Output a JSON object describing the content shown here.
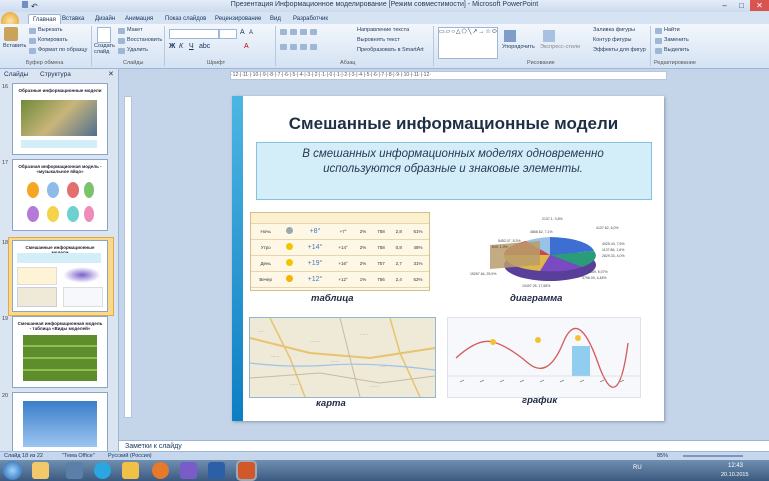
{
  "window": {
    "title": "Презентация Информационное моделирование [Режим совместимости] - Microsoft PowerPoint",
    "min": "–",
    "max": "□",
    "close": "✕"
  },
  "tabs": [
    "Главная",
    "Вставка",
    "Дизайн",
    "Анимация",
    "Показ слайдов",
    "Рецензирование",
    "Вид",
    "Разработчик"
  ],
  "ribbon": {
    "clipboard": {
      "paste": "Вставить",
      "cut": "Вырезать",
      "copy": "Копировать",
      "format": "Формат по образцу",
      "group": "Буфер обмена"
    },
    "slides": {
      "create": "Создать слайд",
      "layout": "Макет",
      "reset": "Восстановить",
      "delete": "Удалить",
      "group": "Слайды"
    },
    "font_group": "Шрифт",
    "paragraph": {
      "direction": "Направление текста",
      "align": "Выровнять текст",
      "smartart": "Преобразовать в SmartArt",
      "group": "Абзац"
    },
    "drawing": {
      "arrange": "Упорядочить",
      "styles": "Экспресс-стили",
      "fill": "Заливка фигуры",
      "outline": "Контур фигуры",
      "effects": "Эффекты для фигур",
      "group": "Рисование"
    },
    "editing": {
      "find": "Найти",
      "replace": "Заменить",
      "select": "Выделить",
      "group": "Редактирование"
    }
  },
  "left_panel": {
    "tab_slides": "Слайды",
    "tab_outline": "Структура",
    "thumbs": [
      {
        "num": "16",
        "title": "Образные информационные модели"
      },
      {
        "num": "17",
        "title": "Образная информационная модель - «музыкальное яйцо»"
      },
      {
        "num": "18",
        "title": "Смешанные информационные модели"
      },
      {
        "num": "19",
        "title": "Смешанная информационная модель - таблица «Виды моделей»"
      },
      {
        "num": "20",
        "title": ""
      }
    ]
  },
  "ruler": "·12·|·11·|·10·|·9·|·8·|·7·|·6·|·5·|·4·|·3·|·2·|·1·|·0·|·1·|·2·|·3·|·4·|·5·|·6·|·7·|·8·|·9·|·10·|·11·|·12·",
  "slide": {
    "title": "Смешанные информационные модели",
    "subtitle": "В смешанных информационных моделях одновременно используются образные и знаковые элементы.",
    "cap_table": "таблица",
    "cap_diagram": "диаграмма",
    "cap_map": "карта",
    "cap_graph": "график",
    "weather_rows": [
      {
        "part": "Ночь",
        "temp": "+8°",
        "feel": "+7°",
        "p": "2%",
        "mm": "758",
        "w": "2,8",
        "h": "61%"
      },
      {
        "part": "Утро",
        "temp": "+14°",
        "feel": "+14°",
        "p": "2%",
        "mm": "758",
        "w": "0,8",
        "h": "48%"
      },
      {
        "part": "День",
        "temp": "+19°",
        "feel": "+16°",
        "p": "2%",
        "mm": "757",
        "w": "2,7",
        "h": "31%"
      },
      {
        "part": "Вечер",
        "temp": "+12°",
        "feel": "+12°",
        "p": "1%",
        "mm": "756",
        "w": "2,4",
        "h": "52%"
      }
    ]
  },
  "notes": "Заметки к слайду",
  "status": {
    "slide": "Слайд 18 из 22",
    "theme": "\"Тема Office\"",
    "lang": "Русский (Россия)",
    "zoom": "85%"
  },
  "taskbar": {
    "lang": "RU",
    "time": "12:43",
    "date": "20.10.2015"
  },
  "colors": {
    "accent": "#0d7ec2",
    "ribbon": "#d4e2f3",
    "selected_thumb": "#f9d98a"
  }
}
